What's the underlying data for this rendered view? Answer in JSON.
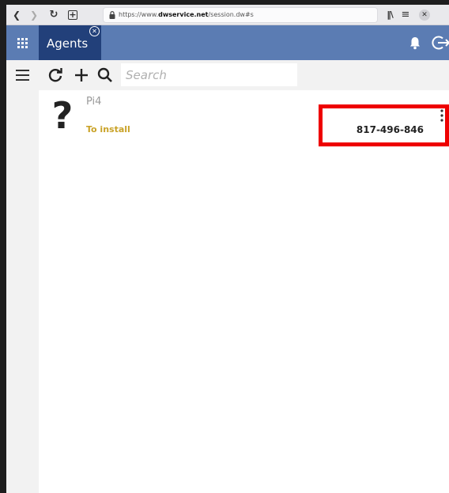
{
  "browser": {
    "back_icon": "chevron-left-icon",
    "forward_icon": "chevron-right-icon",
    "reload_icon": "reload-icon",
    "url_prefix": "https://www.",
    "url_domain": "dwservice.net",
    "url_path": "/session.dw#s",
    "library_icon": "library-icon",
    "menu_icon": "menu-icon",
    "close_icon": "close-icon"
  },
  "header": {
    "tab_title": "Agents",
    "colors": {
      "header_bg": "#5b7cb3",
      "tab_bg": "#22407a"
    }
  },
  "toolbar": {
    "search_placeholder": "Search"
  },
  "agents": [
    {
      "name": "Pi4",
      "status": "To install",
      "code": "817-496-846",
      "status_color": "#c9a227"
    }
  ],
  "highlight_color": "#ee0000"
}
